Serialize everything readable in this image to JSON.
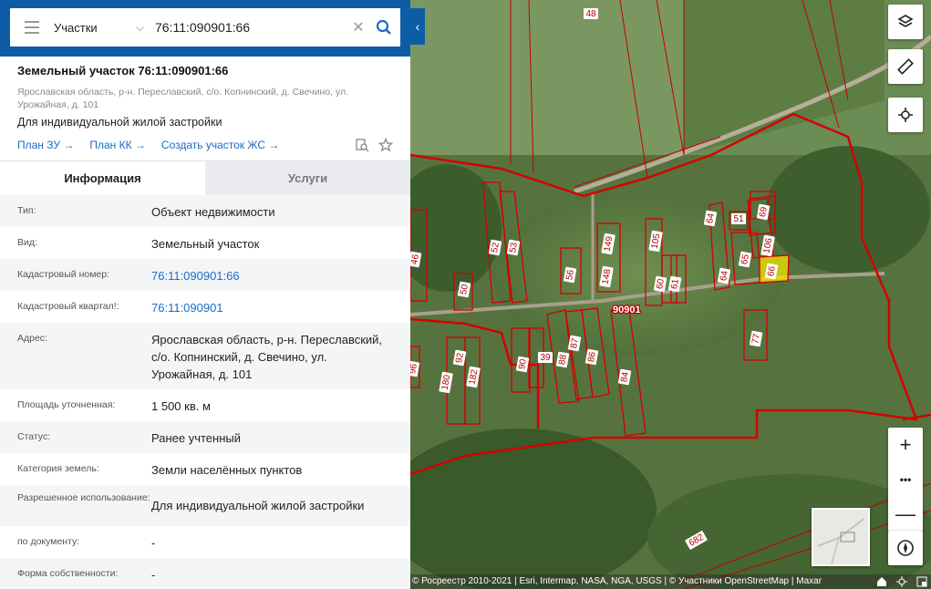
{
  "search": {
    "mode": "Участки",
    "query": "76:11:090901:66"
  },
  "object": {
    "title": "Земельный участок 76:11:090901:66",
    "address": "Ярославская область, р-н. Переславский, с/о. Копнинский, д. Свечино, ул. Урожайная, д. 101",
    "usage": "Для индивидуальной жилой застройки",
    "links": [
      "План ЗУ →",
      "План КК →",
      "Создать участок ЖС →"
    ]
  },
  "tabs": [
    "Информация",
    "Услуги"
  ],
  "info": [
    {
      "label": "Тип:",
      "value": "Объект недвижимости"
    },
    {
      "label": "Вид:",
      "value": "Земельный участок"
    },
    {
      "label": "Кадастровый номер:",
      "value": "76:11:090901:66"
    },
    {
      "label": "Кадастровый квартал!:",
      "value": "76:11:090901"
    },
    {
      "label": "Адрес:",
      "value": "Ярославская область, р-н. Переславский, с/о. Копнинский, д. Свечино, ул. Урожайная, д. 101"
    },
    {
      "label": "Площадь уточненная:",
      "value": "1 500 кв. м"
    },
    {
      "label": "Статус:",
      "value": "Ранее учтенный"
    },
    {
      "label": "Категория земель:",
      "value": "Земли населённых пунктов"
    },
    {
      "label": "Разрешенное использование:",
      "value": "Для индивидуальной жилой застройки"
    },
    {
      "label": "по документу:",
      "value": "-"
    },
    {
      "label": "Форма собственности:",
      "value": "-"
    }
  ],
  "map": {
    "quarter_label": "90901",
    "parcel_labels": [
      "48",
      "46",
      "50",
      "52",
      "53",
      "56",
      "149",
      "148",
      "105",
      "60",
      "61",
      "64",
      "51",
      "69",
      "65",
      "106",
      "64",
      "66",
      "77",
      "90",
      "39",
      "88",
      "87",
      "86",
      "84",
      "180",
      "92",
      "182",
      "96",
      "682"
    ],
    "attribution": "© Росреестр 2010-2021 | Esri, Intermap, NASA, NGA, USGS | © Участники OpenStreetMap | Maxar",
    "zoom_in": "+",
    "zoom_more": "•••",
    "zoom_out": "—"
  },
  "colors": {
    "brand": "#0f5ca6",
    "link": "#1a6bc4",
    "parcel_border": "#d40000",
    "selected_parcel": "#f2e600"
  }
}
